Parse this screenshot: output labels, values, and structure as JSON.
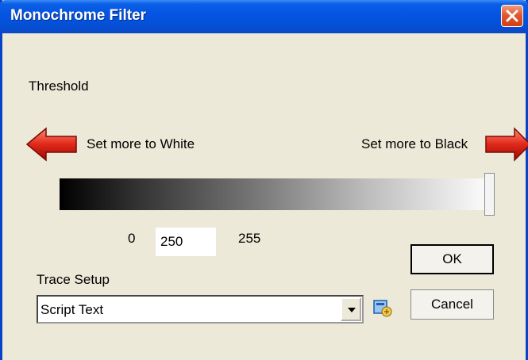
{
  "window": {
    "title": "Monochrome Filter"
  },
  "threshold": {
    "label": "Threshold",
    "left_hint": "Set more to White",
    "right_hint": "Set more to Black",
    "min_label": "0",
    "max_label": "255",
    "value": "250",
    "slider_fraction": 0.98
  },
  "trace_setup": {
    "label": "Trace Setup",
    "selected": "Script Text"
  },
  "buttons": {
    "ok": "OK",
    "cancel": "Cancel"
  },
  "icons": {
    "close": "close-icon",
    "left_arrow": "red-left-arrow-icon",
    "right_arrow": "red-right-arrow-icon",
    "dropdown": "chevron-down-icon",
    "setup": "setup-icon"
  }
}
